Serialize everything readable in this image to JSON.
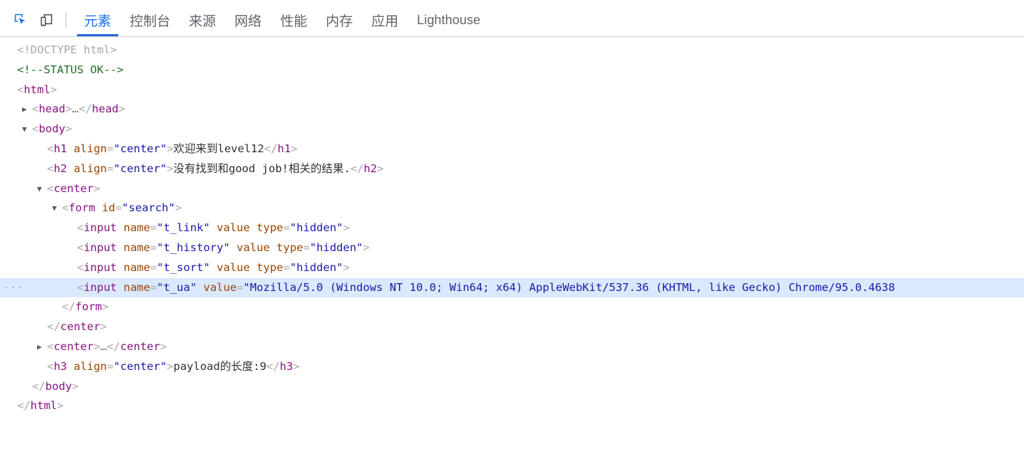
{
  "window": {
    "clipped_text_above": "▪ ▪▪▪▪▪▪▪"
  },
  "toolbar": {
    "icons": [
      {
        "name": "inspect-element-icon",
        "label": "检查元素",
        "active": true
      },
      {
        "name": "device-toolbar-icon",
        "label": "切换设备工具栏",
        "active": false
      }
    ],
    "tabs": [
      {
        "label": "元素",
        "active": true,
        "latin": false
      },
      {
        "label": "控制台",
        "active": false,
        "latin": false
      },
      {
        "label": "来源",
        "active": false,
        "latin": false
      },
      {
        "label": "网络",
        "active": false,
        "latin": false
      },
      {
        "label": "性能",
        "active": false,
        "latin": false
      },
      {
        "label": "内存",
        "active": false,
        "latin": false
      },
      {
        "label": "应用",
        "active": false,
        "latin": false
      },
      {
        "label": "Lighthouse",
        "active": false,
        "latin": true
      }
    ],
    "accent_color": "#1a73e8",
    "active_underline_color": "#2a66d9"
  },
  "dom_tree": {
    "selected_row_background": "#dbe9ff",
    "rows": [
      {
        "indent": 0,
        "twisty": "none",
        "selected": false,
        "gutter": "",
        "parts": [
          {
            "t": "doctype",
            "v": "<!DOCTYPE html>"
          }
        ]
      },
      {
        "indent": 0,
        "twisty": "none",
        "selected": false,
        "gutter": "",
        "parts": [
          {
            "t": "comment",
            "v": "<!--STATUS OK-->"
          }
        ]
      },
      {
        "indent": 0,
        "twisty": "none",
        "selected": false,
        "gutter": "",
        "parts": [
          {
            "t": "punct",
            "v": "<"
          },
          {
            "t": "tagname",
            "v": "html"
          },
          {
            "t": "punct",
            "v": ">"
          }
        ]
      },
      {
        "indent": 1,
        "twisty": "collapsed",
        "selected": false,
        "gutter": "",
        "parts": [
          {
            "t": "punct",
            "v": "<"
          },
          {
            "t": "tagname",
            "v": "head"
          },
          {
            "t": "punct",
            "v": ">"
          },
          {
            "t": "collapsed-dots",
            "v": "…"
          },
          {
            "t": "punct",
            "v": "</"
          },
          {
            "t": "tagname",
            "v": "head"
          },
          {
            "t": "punct",
            "v": ">"
          }
        ]
      },
      {
        "indent": 1,
        "twisty": "expanded",
        "selected": false,
        "gutter": "",
        "parts": [
          {
            "t": "punct",
            "v": "<"
          },
          {
            "t": "tagname",
            "v": "body"
          },
          {
            "t": "punct",
            "v": ">"
          }
        ]
      },
      {
        "indent": 2,
        "twisty": "none",
        "selected": false,
        "gutter": "",
        "parts": [
          {
            "t": "punct",
            "v": "<"
          },
          {
            "t": "tagname",
            "v": "h1"
          },
          {
            "t": "sp",
            "v": " "
          },
          {
            "t": "attrname",
            "v": "align"
          },
          {
            "t": "punct",
            "v": "="
          },
          {
            "t": "attrval",
            "v": "\"center\""
          },
          {
            "t": "punct",
            "v": ">"
          },
          {
            "t": "textnode",
            "v": "欢迎来到level12"
          },
          {
            "t": "punct",
            "v": "</"
          },
          {
            "t": "tagname",
            "v": "h1"
          },
          {
            "t": "punct",
            "v": ">"
          }
        ]
      },
      {
        "indent": 2,
        "twisty": "none",
        "selected": false,
        "gutter": "",
        "parts": [
          {
            "t": "punct",
            "v": "<"
          },
          {
            "t": "tagname",
            "v": "h2"
          },
          {
            "t": "sp",
            "v": " "
          },
          {
            "t": "attrname",
            "v": "align"
          },
          {
            "t": "punct",
            "v": "="
          },
          {
            "t": "attrval",
            "v": "\"center\""
          },
          {
            "t": "punct",
            "v": ">"
          },
          {
            "t": "textnode",
            "v": "没有找到和good job!相关的结果."
          },
          {
            "t": "punct",
            "v": "</"
          },
          {
            "t": "tagname",
            "v": "h2"
          },
          {
            "t": "punct",
            "v": ">"
          }
        ]
      },
      {
        "indent": 2,
        "twisty": "expanded",
        "selected": false,
        "gutter": "",
        "parts": [
          {
            "t": "punct",
            "v": "<"
          },
          {
            "t": "tagname",
            "v": "center"
          },
          {
            "t": "punct",
            "v": ">"
          }
        ]
      },
      {
        "indent": 3,
        "twisty": "expanded",
        "selected": false,
        "gutter": "",
        "parts": [
          {
            "t": "punct",
            "v": "<"
          },
          {
            "t": "tagname",
            "v": "form"
          },
          {
            "t": "sp",
            "v": " "
          },
          {
            "t": "attrname",
            "v": "id"
          },
          {
            "t": "punct",
            "v": "="
          },
          {
            "t": "attrval",
            "v": "\"search\""
          },
          {
            "t": "punct",
            "v": ">"
          }
        ]
      },
      {
        "indent": 4,
        "twisty": "none",
        "selected": false,
        "gutter": "",
        "parts": [
          {
            "t": "punct",
            "v": "<"
          },
          {
            "t": "tagname",
            "v": "input"
          },
          {
            "t": "sp",
            "v": " "
          },
          {
            "t": "attrname",
            "v": "name"
          },
          {
            "t": "punct",
            "v": "="
          },
          {
            "t": "attrval",
            "v": "\"t_link\""
          },
          {
            "t": "sp",
            "v": " "
          },
          {
            "t": "attrname",
            "v": "value"
          },
          {
            "t": "sp",
            "v": " "
          },
          {
            "t": "attrname",
            "v": "type"
          },
          {
            "t": "punct",
            "v": "="
          },
          {
            "t": "attrval",
            "v": "\"hidden\""
          },
          {
            "t": "punct",
            "v": ">"
          }
        ]
      },
      {
        "indent": 4,
        "twisty": "none",
        "selected": false,
        "gutter": "",
        "parts": [
          {
            "t": "punct",
            "v": "<"
          },
          {
            "t": "tagname",
            "v": "input"
          },
          {
            "t": "sp",
            "v": " "
          },
          {
            "t": "attrname",
            "v": "name"
          },
          {
            "t": "punct",
            "v": "="
          },
          {
            "t": "attrval",
            "v": "\"t_history\""
          },
          {
            "t": "sp",
            "v": " "
          },
          {
            "t": "attrname",
            "v": "value"
          },
          {
            "t": "sp",
            "v": " "
          },
          {
            "t": "attrname",
            "v": "type"
          },
          {
            "t": "punct",
            "v": "="
          },
          {
            "t": "attrval",
            "v": "\"hidden\""
          },
          {
            "t": "punct",
            "v": ">"
          }
        ]
      },
      {
        "indent": 4,
        "twisty": "none",
        "selected": false,
        "gutter": "",
        "parts": [
          {
            "t": "punct",
            "v": "<"
          },
          {
            "t": "tagname",
            "v": "input"
          },
          {
            "t": "sp",
            "v": " "
          },
          {
            "t": "attrname",
            "v": "name"
          },
          {
            "t": "punct",
            "v": "="
          },
          {
            "t": "attrval",
            "v": "\"t_sort\""
          },
          {
            "t": "sp",
            "v": " "
          },
          {
            "t": "attrname",
            "v": "value"
          },
          {
            "t": "sp",
            "v": " "
          },
          {
            "t": "attrname",
            "v": "type"
          },
          {
            "t": "punct",
            "v": "="
          },
          {
            "t": "attrval",
            "v": "\"hidden\""
          },
          {
            "t": "punct",
            "v": ">"
          }
        ]
      },
      {
        "indent": 4,
        "twisty": "none",
        "selected": true,
        "gutter": "···",
        "parts": [
          {
            "t": "punct",
            "v": "<"
          },
          {
            "t": "tagname",
            "v": "input"
          },
          {
            "t": "sp",
            "v": " "
          },
          {
            "t": "attrname",
            "v": "name"
          },
          {
            "t": "punct",
            "v": "="
          },
          {
            "t": "attrval",
            "v": "\"t_ua\""
          },
          {
            "t": "sp",
            "v": " "
          },
          {
            "t": "attrname",
            "v": "value"
          },
          {
            "t": "punct",
            "v": "="
          },
          {
            "t": "attrval",
            "v": "\"Mozilla/5.0 (Windows NT 10.0; Win64; x64) AppleWebKit/537.36 (KHTML, like Gecko) Chrome/95.0.4638"
          }
        ]
      },
      {
        "indent": 3,
        "twisty": "none",
        "selected": false,
        "gutter": "",
        "parts": [
          {
            "t": "punct",
            "v": "</"
          },
          {
            "t": "tagname",
            "v": "form"
          },
          {
            "t": "punct",
            "v": ">"
          }
        ]
      },
      {
        "indent": 2,
        "twisty": "none",
        "selected": false,
        "gutter": "",
        "parts": [
          {
            "t": "punct",
            "v": "</"
          },
          {
            "t": "tagname",
            "v": "center"
          },
          {
            "t": "punct",
            "v": ">"
          }
        ]
      },
      {
        "indent": 2,
        "twisty": "collapsed",
        "selected": false,
        "gutter": "",
        "parts": [
          {
            "t": "punct",
            "v": "<"
          },
          {
            "t": "tagname",
            "v": "center"
          },
          {
            "t": "punct",
            "v": ">"
          },
          {
            "t": "collapsed-dots",
            "v": "…"
          },
          {
            "t": "punct",
            "v": "</"
          },
          {
            "t": "tagname",
            "v": "center"
          },
          {
            "t": "punct",
            "v": ">"
          }
        ]
      },
      {
        "indent": 2,
        "twisty": "none",
        "selected": false,
        "gutter": "",
        "parts": [
          {
            "t": "punct",
            "v": "<"
          },
          {
            "t": "tagname",
            "v": "h3"
          },
          {
            "t": "sp",
            "v": " "
          },
          {
            "t": "attrname",
            "v": "align"
          },
          {
            "t": "punct",
            "v": "="
          },
          {
            "t": "attrval",
            "v": "\"center\""
          },
          {
            "t": "punct",
            "v": ">"
          },
          {
            "t": "textnode",
            "v": "payload的长度:9"
          },
          {
            "t": "punct",
            "v": "</"
          },
          {
            "t": "tagname",
            "v": "h3"
          },
          {
            "t": "punct",
            "v": ">"
          }
        ]
      },
      {
        "indent": 1,
        "twisty": "none",
        "selected": false,
        "gutter": "",
        "parts": [
          {
            "t": "punct",
            "v": "</"
          },
          {
            "t": "tagname",
            "v": "body"
          },
          {
            "t": "punct",
            "v": ">"
          }
        ]
      },
      {
        "indent": 0,
        "twisty": "none",
        "selected": false,
        "gutter": "",
        "parts": [
          {
            "t": "punct",
            "v": "</"
          },
          {
            "t": "tagname",
            "v": "html"
          },
          {
            "t": "punct",
            "v": ">"
          }
        ]
      }
    ]
  }
}
